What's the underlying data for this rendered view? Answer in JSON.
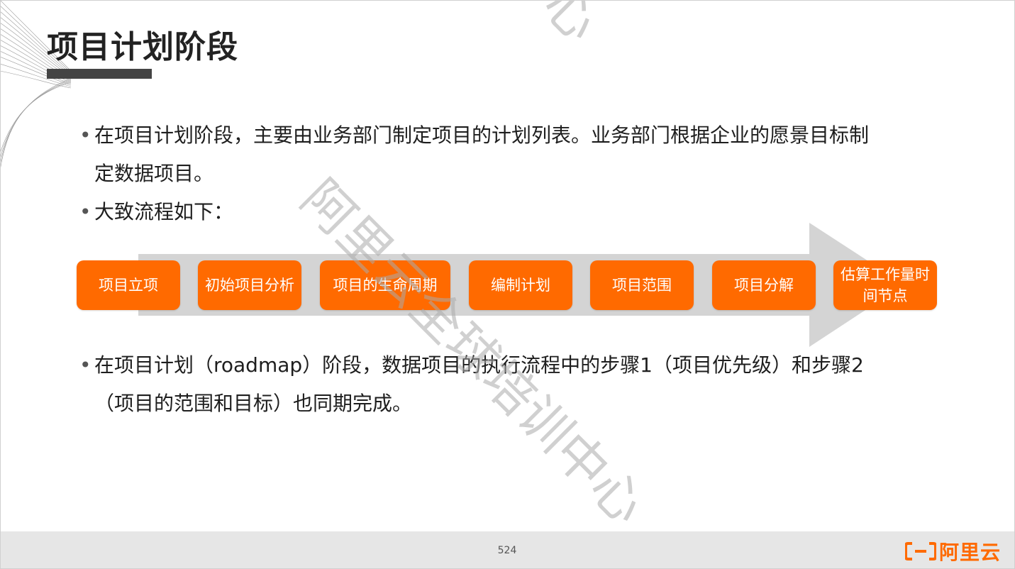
{
  "slide": {
    "title": "项目计划阶段",
    "bullets": [
      {
        "line1": "在项目计划阶段，主要由业务部门制定项目的计划列表。业务部门根据企业的愿景目标制",
        "line2": "定数据项目。"
      },
      {
        "line1": "大致流程如下："
      },
      {
        "line1": "在项目计划（roadmap）阶段，数据项目的执行流程中的步骤1（项目优先级）和步骤2",
        "line2": "（项目的范围和目标）也同期完成。"
      }
    ],
    "bullet_symbol": "•",
    "flow_steps": [
      "项目立项",
      "初始项目分析",
      "项目的生命周期",
      "编制计划",
      "项目范围",
      "项目分解",
      "估算工作量时间节点"
    ]
  },
  "watermark": {
    "text_top": "训中心",
    "text_main": "阿里云全球培训中心"
  },
  "footer": {
    "page_number": "524",
    "logo_text": "阿里云"
  },
  "colors": {
    "accent": "#ff6a00",
    "title_bar": "#444444",
    "arrow": "#d4d4d4",
    "footer": "#e6e6e6"
  }
}
